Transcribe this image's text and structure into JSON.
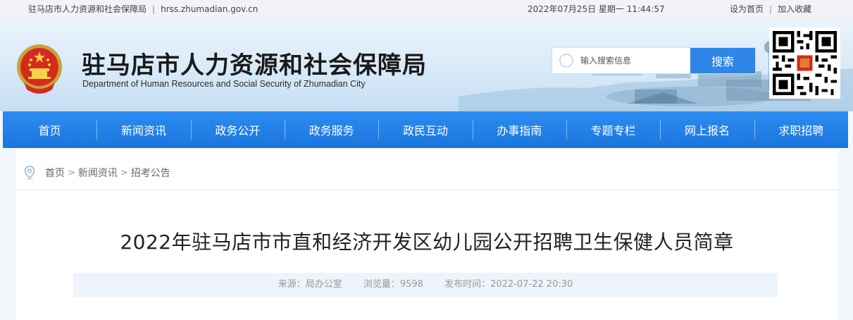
{
  "topbar": {
    "site_name": "驻马店市人力资源和社会保障局",
    "separator": "|",
    "domain": "hrss.zhumadian.gov.cn",
    "datetime": "2022年07月25日 星期一 11:44:57",
    "set_homepage": "设为首页",
    "add_favorite": "加入收藏"
  },
  "header": {
    "title": "驻马店市人力资源和社会保障局",
    "subtitle": "Department of Human Resources and Social Security of Zhumadian City",
    "emblem_icon": "national-emblem-icon"
  },
  "search": {
    "placeholder": "输入搜索信息",
    "value": "",
    "button_label": "搜索",
    "icon": "search-icon"
  },
  "nav": {
    "items": [
      {
        "label": "首页"
      },
      {
        "label": "新闻资讯"
      },
      {
        "label": "政务公开"
      },
      {
        "label": "政务服务"
      },
      {
        "label": "政民互动"
      },
      {
        "label": "办事指南"
      },
      {
        "label": "专题专栏"
      },
      {
        "label": "网上报名"
      },
      {
        "label": "求职招聘"
      }
    ]
  },
  "breadcrumb": {
    "icon": "location-pin-icon",
    "items": [
      "首页",
      "新闻资讯",
      "招考公告"
    ],
    "arrow": ">"
  },
  "article": {
    "title": "2022年驻马店市市直和经济开发区幼儿园公开招聘卫生保健人员简章",
    "source": "来源：局办公室",
    "views": "浏览量：9598",
    "published": "发布时间：2022-07-22 20:30"
  },
  "colors": {
    "nav_blue": "#2283ec",
    "search_button": "#2f86e6",
    "meta_bg": "#eef4fb"
  }
}
